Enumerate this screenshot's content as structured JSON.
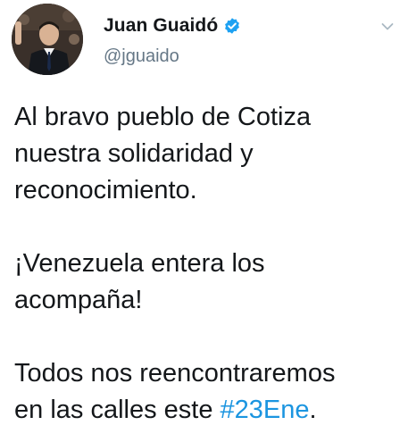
{
  "author": {
    "display_name": "Juan Guaidó",
    "handle": "@jguaido",
    "verified": true,
    "avatar_icon": "profile-photo",
    "verified_icon": "verified-badge-icon"
  },
  "menu": {
    "icon": "chevron-down-icon"
  },
  "tweet": {
    "p1": {
      "l1": "Al bravo pueblo de Cotiza",
      "l2": "nuestra solidaridad y",
      "l3": "reconocimiento."
    },
    "p2": {
      "l1": "¡Venezuela entera los",
      "l2": "acompaña!"
    },
    "p3": {
      "l1": "Todos nos reencontraremos",
      "l2_prefix": "en las calles este ",
      "hashtag": "#23Ene",
      "l2_suffix": "."
    }
  },
  "colors": {
    "text": "#14171a",
    "secondary": "#657786",
    "accent": "#1b95e0",
    "verified": "#1da1f2"
  }
}
